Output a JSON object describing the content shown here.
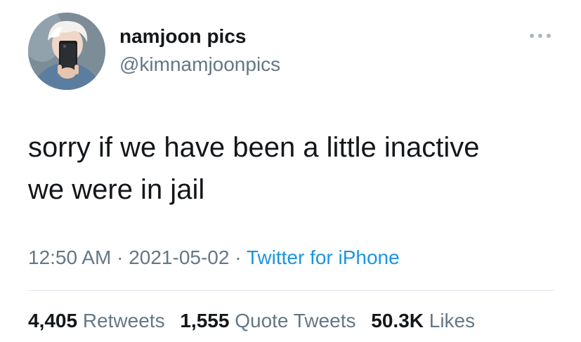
{
  "author": {
    "display_name": "namjoon pics",
    "handle": "@kimnamjoonpics"
  },
  "icons": {
    "more": "more-horizontal-icon",
    "avatar": "profile-photo"
  },
  "tweet": {
    "line1": "sorry if we have been a little inactive",
    "line2": "we were in jail"
  },
  "meta": {
    "time": "12:50 AM",
    "separator": " · ",
    "date": "2021-05-02",
    "source": "Twitter for iPhone"
  },
  "stats": {
    "retweets_count": "4,405",
    "retweets_label": "Retweets",
    "quotes_count": "1,555",
    "quotes_label": "Quote Tweets",
    "likes_count": "50.3K",
    "likes_label": "Likes"
  },
  "colors": {
    "text": "#14171a",
    "secondary": "#657786",
    "link": "#1b95e0",
    "divider": "#e1e8ed"
  }
}
